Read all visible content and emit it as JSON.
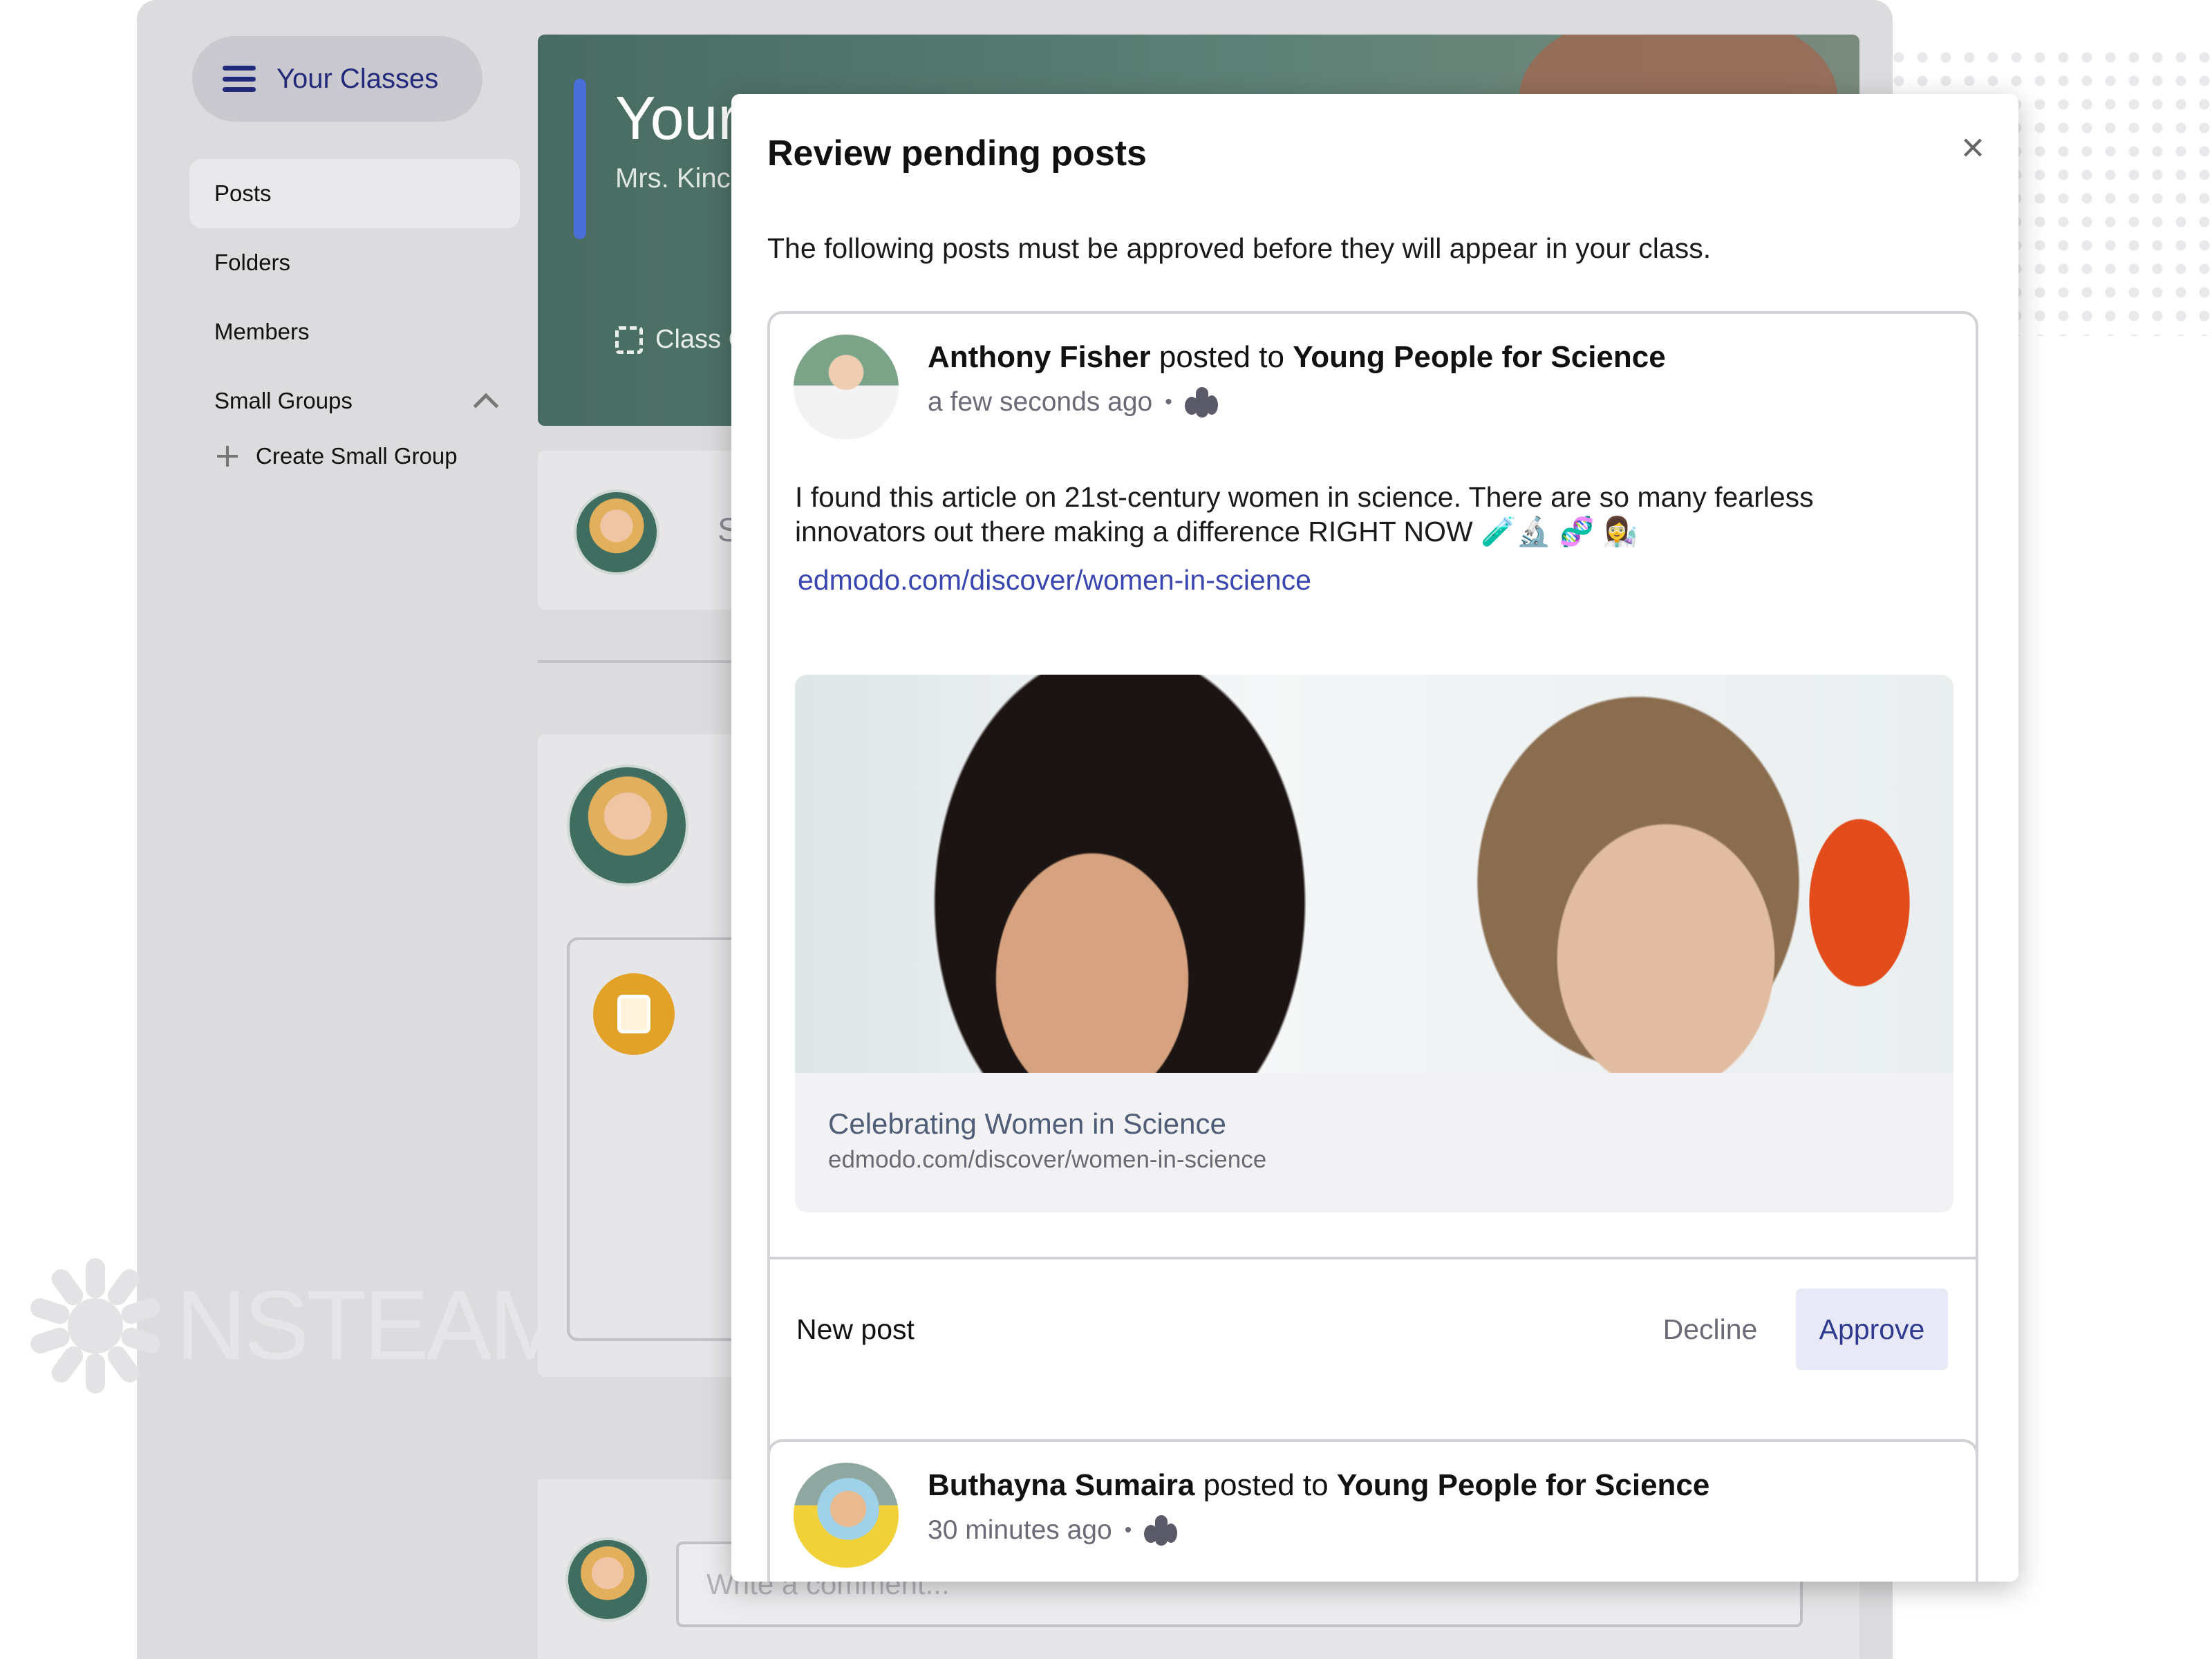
{
  "sidebar": {
    "classes_button": "Your Classes",
    "items": [
      {
        "label": "Posts"
      },
      {
        "label": "Folders"
      },
      {
        "label": "Members"
      }
    ],
    "small_groups": {
      "label": "Small Groups",
      "create_label": "Create Small Group"
    }
  },
  "banner": {
    "title": "Your",
    "teacher": "Mrs. Kinc",
    "code_label": "Class C"
  },
  "feed": {
    "composer_hint": "S",
    "comment_placeholder": "Write a comment..."
  },
  "logo": {
    "text": "NSTEAM"
  },
  "modal": {
    "title": "Review pending posts",
    "close": "×",
    "subtitle": "The following posts must be approved before they will appear in your class.",
    "posts": [
      {
        "author": "Anthony Fisher",
        "posted_to": "posted to",
        "group": "Young People for Science",
        "time": "a few seconds ago",
        "body": "I found this article on 21st-century women in science. There are so many fearless innovators out there making a difference RIGHT NOW 🧪🔬 🧬 👩‍🔬",
        "link": "edmodo.com/discover/women-in-science",
        "preview_title": "Celebrating Women in Science",
        "preview_url": "edmodo.com/discover/women-in-science",
        "footer_label": "New post",
        "decline": "Decline",
        "approve": "Approve"
      },
      {
        "author": "Buthayna Sumaira",
        "posted_to": "posted to",
        "group": "Young People for Science",
        "time": "30 minutes ago"
      }
    ]
  },
  "colors": {
    "accent": "#2f3a8f",
    "link": "#3a46b0",
    "banner_green": "#486b62",
    "assignment_orange": "#e2a127"
  }
}
